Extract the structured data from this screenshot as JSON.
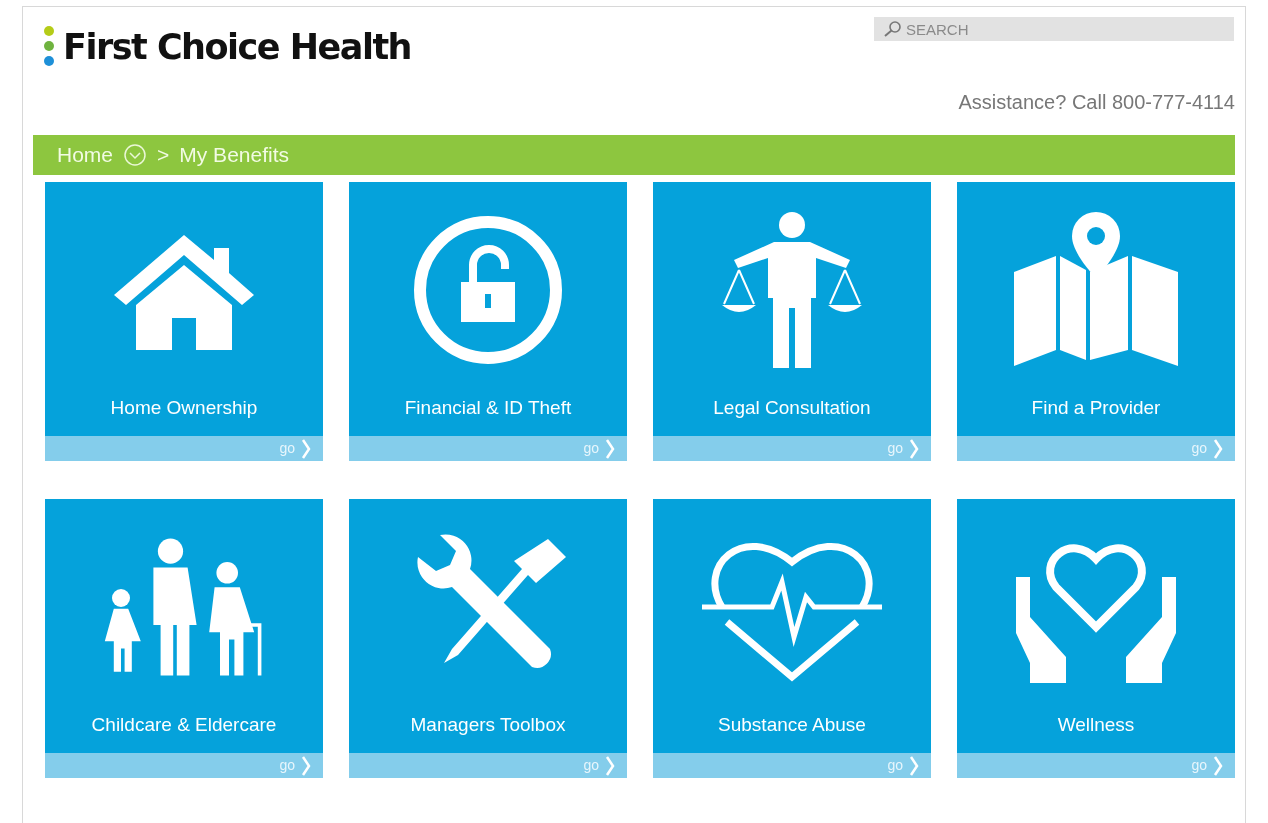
{
  "header": {
    "logo": "First Choice Health",
    "search": {
      "placeholder": "SEARCH"
    },
    "assistance": "Assistance? Call 800-777-4114"
  },
  "breadcrumb": [
    {
      "label": "Home"
    },
    {
      "label": ">"
    },
    {
      "label": "My Benefits"
    }
  ],
  "tiles": [
    {
      "kind": "house",
      "title": "Home Ownership",
      "link": "go"
    },
    {
      "kind": "lock",
      "title": "Financial & ID Theft",
      "link": "go"
    },
    {
      "kind": "scales",
      "title": "Legal Consultation",
      "link": "go"
    },
    {
      "kind": "map",
      "title": "Find a Provider",
      "link": "go"
    },
    {
      "kind": "family",
      "title": "Childcare & Eldercare",
      "link": "go"
    },
    {
      "kind": "tools",
      "title": "Managers Toolbox",
      "link": "go"
    },
    {
      "kind": "heartbeat",
      "title": "Substance Abuse",
      "link": "go"
    },
    {
      "kind": "hands",
      "title": "Wellness",
      "link": "go"
    }
  ]
}
